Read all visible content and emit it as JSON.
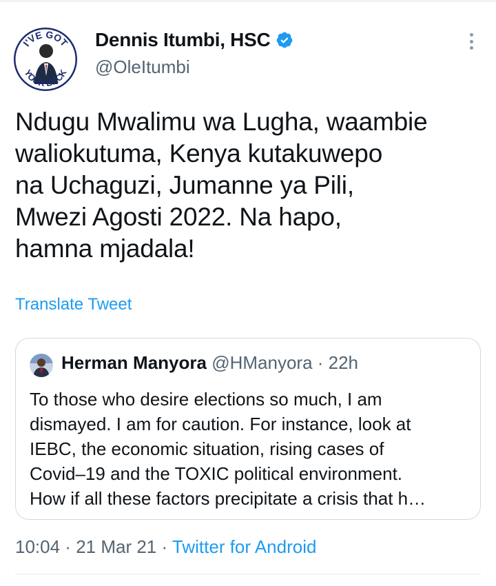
{
  "tweet": {
    "author": {
      "display_name": "Dennis Itumbi, HSC",
      "handle": "@OleItumbi",
      "verified": true,
      "avatar_text_top": "I'VE GOT",
      "avatar_text_bottom": "YOUR BACK"
    },
    "text": "Ndugu Mwalimu wa Lugha, waambie\nwaliokutuma, Kenya kutakuwepo\nna Uchaguzi, Jumanne ya Pili,\nMwezi Agosti 2022. Na hapo,\nhamna mjadala!",
    "translate_label": "Translate Tweet",
    "quoted": {
      "display_name": "Herman Manyora",
      "handle": "@HManyora",
      "separator": " · ",
      "time": "22h",
      "text": "To those who desire elections so much, I am\ndismayed. I am for caution. For instance, look at\nIEBC, the economic situation, rising cases of\nCovid–19 and the TOXIC political environment.\nHow if all these factors precipitate a crisis that h…"
    },
    "footer": {
      "time": "10:04",
      "separator": " · ",
      "date": "21 Mar 21",
      "app": "Twitter for Android"
    }
  },
  "colors": {
    "accent": "#1d9bf0",
    "text": "#0f1419",
    "secondary": "#536471",
    "border": "#cfd9de"
  },
  "icons": {
    "verified": "verified-badge-icon",
    "more": "more-options-icon"
  }
}
